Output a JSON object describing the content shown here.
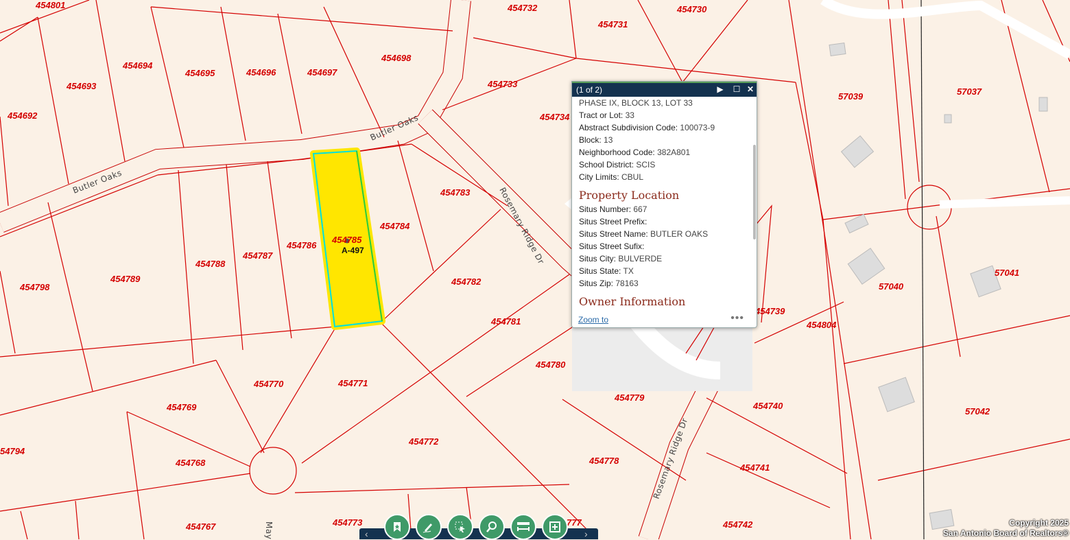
{
  "colors": {
    "lot_line": "#d40000",
    "highlight": "#ffe600",
    "highlight_outline": "#00e0e0",
    "toolbar": "#14324f",
    "tool_button": "#3f9a68",
    "section_title": "#8b2b1c"
  },
  "lots": [
    {
      "id": "454801",
      "label": "454801"
    },
    {
      "id": "454732",
      "label": "454732"
    },
    {
      "id": "454730",
      "label": "454730"
    },
    {
      "id": "454731",
      "label": "454731"
    },
    {
      "id": "454694",
      "label": "454694"
    },
    {
      "id": "454695",
      "label": "454695"
    },
    {
      "id": "454696",
      "label": "454696"
    },
    {
      "id": "454697",
      "label": "454697"
    },
    {
      "id": "454698",
      "label": "454698"
    },
    {
      "id": "454693",
      "label": "454693"
    },
    {
      "id": "454733",
      "label": "454733"
    },
    {
      "id": "454692",
      "label": "454692"
    },
    {
      "id": "454734",
      "label": "454734"
    },
    {
      "id": "57039",
      "label": "57039"
    },
    {
      "id": "57037",
      "label": "57037"
    },
    {
      "id": "454783",
      "label": "454783"
    },
    {
      "id": "454784",
      "label": "454784"
    },
    {
      "id": "454785",
      "label": "454785"
    },
    {
      "id": "454786",
      "label": "454786"
    },
    {
      "id": "454787",
      "label": "454787"
    },
    {
      "id": "454788",
      "label": "454788"
    },
    {
      "id": "454789",
      "label": "454789"
    },
    {
      "id": "454798",
      "label": "454798"
    },
    {
      "id": "454782",
      "label": "454782"
    },
    {
      "id": "454781",
      "label": "454781"
    },
    {
      "id": "454780",
      "label": "454780"
    },
    {
      "id": "454739",
      "label": "454739"
    },
    {
      "id": "454804",
      "label": "454804"
    },
    {
      "id": "57040",
      "label": "57040"
    },
    {
      "id": "57041",
      "label": "57041"
    },
    {
      "id": "454770",
      "label": "454770"
    },
    {
      "id": "454771",
      "label": "454771"
    },
    {
      "id": "454769",
      "label": "454769"
    },
    {
      "id": "454779",
      "label": "454779"
    },
    {
      "id": "454740",
      "label": "454740"
    },
    {
      "id": "57042",
      "label": "57042"
    },
    {
      "id": "454794",
      "label": "54794"
    },
    {
      "id": "454772",
      "label": "454772"
    },
    {
      "id": "454768",
      "label": "454768"
    },
    {
      "id": "454778",
      "label": "454778"
    },
    {
      "id": "454741",
      "label": "454741"
    },
    {
      "id": "454767",
      "label": "454767"
    },
    {
      "id": "454773",
      "label": "454773"
    },
    {
      "id": "454777",
      "label": "777"
    },
    {
      "id": "454742",
      "label": "454742"
    }
  ],
  "streets": {
    "butler_oaks_1": "Butler Oaks",
    "butler_oaks_2": "Butler Oaks",
    "rosemary_1": "Rosemary Ridge Dr",
    "rosemary_2": "Rosemary Ridge Dr",
    "may": "May"
  },
  "highlight_label": "A-497",
  "popup": {
    "count": "(1 of 2)",
    "rows_top": [
      {
        "k": "",
        "v": "PHASE IX, BLOCK 13, LOT 33"
      },
      {
        "k": "Tract or Lot:",
        "v": "33"
      },
      {
        "k": "Abstract Subdivision Code:",
        "v": "100073-9"
      },
      {
        "k": "Block:",
        "v": "13"
      },
      {
        "k": "Neighborhood Code:",
        "v": "382A801"
      },
      {
        "k": "School District:",
        "v": "SCIS"
      },
      {
        "k": "City Limits:",
        "v": "CBUL"
      }
    ],
    "section_property": "Property Location",
    "rows_location": [
      {
        "k": "Situs Number:",
        "v": "667"
      },
      {
        "k": "Situs Street Prefix:",
        "v": ""
      },
      {
        "k": "Situs Street Name:",
        "v": "BUTLER OAKS"
      },
      {
        "k": "Situs Street Sufix:",
        "v": ""
      },
      {
        "k": "Situs City:",
        "v": "BULVERDE"
      },
      {
        "k": "Situs State:",
        "v": "TX"
      },
      {
        "k": "Situs Zip:",
        "v": "78163"
      }
    ],
    "section_owner": "Owner Information",
    "zoom_label": "Zoom to",
    "more_label": "•••"
  },
  "toolbar": {
    "prev": "‹",
    "next": "›",
    "tools": [
      "bookmark-icon",
      "draw-icon",
      "select-icon",
      "search-map-icon",
      "measure-icon",
      "add-layer-icon"
    ]
  },
  "copyright": {
    "line1": "Copyright 2025",
    "line2": "San Antonio Board of Realtors®"
  }
}
